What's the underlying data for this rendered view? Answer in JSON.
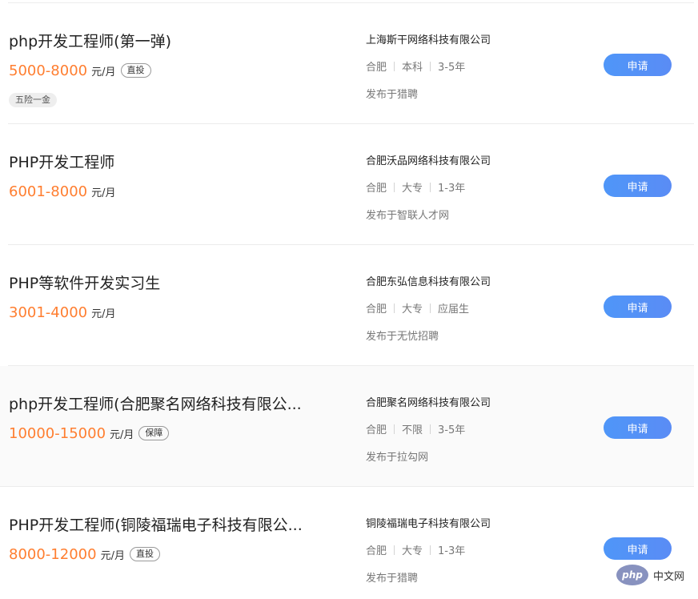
{
  "jobs": [
    {
      "title": "php开发工程师(第一弹)",
      "salary": "5000-8000",
      "unit": "元/月",
      "tag": "直投",
      "perk": "五险一金",
      "company": "上海斯干网络科技有限公司",
      "city": "合肥",
      "education": "本科",
      "experience": "3-5年",
      "source": "发布于猎聘",
      "apply_label": "申请"
    },
    {
      "title": "PHP开发工程师",
      "salary": "6001-8000",
      "unit": "元/月",
      "tag": "",
      "perk": "",
      "company": "合肥沃品网络科技有限公司",
      "city": "合肥",
      "education": "大专",
      "experience": "1-3年",
      "source": "发布于智联人才网",
      "apply_label": "申请"
    },
    {
      "title": "PHP等软件开发实习生",
      "salary": "3001-4000",
      "unit": "元/月",
      "tag": "",
      "perk": "",
      "company": "合肥东弘信息科技有限公司",
      "city": "合肥",
      "education": "大专",
      "experience": "应届生",
      "source": "发布于无忧招聘",
      "apply_label": "申请"
    },
    {
      "title": "php开发工程师(合肥聚名网络科技有限公...",
      "salary": "10000-15000",
      "unit": "元/月",
      "tag": "保障",
      "perk": "",
      "company": "合肥聚名网络科技有限公司",
      "city": "合肥",
      "education": "不限",
      "experience": "3-5年",
      "source": "发布于拉勾网",
      "apply_label": "申请"
    },
    {
      "title": "PHP开发工程师(铜陵福瑞电子科技有限公...",
      "salary": "8000-12000",
      "unit": "元/月",
      "tag": "直投",
      "perk": "",
      "company": "铜陵福瑞电子科技有限公司",
      "city": "合肥",
      "education": "大专",
      "experience": "1-3年",
      "source": "发布于猎聘",
      "apply_label": "申请"
    }
  ],
  "watermark": {
    "logo_text": "php",
    "site_name": "中文网"
  },
  "colors": {
    "salary": "#ff7e30",
    "apply_button": "#5291f7"
  }
}
